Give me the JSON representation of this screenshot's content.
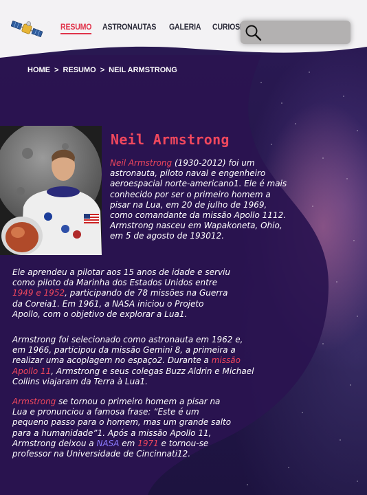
{
  "nav": {
    "items": [
      {
        "label": "RESUMO",
        "active": true
      },
      {
        "label": "ASTRONAUTAS",
        "active": false
      },
      {
        "label": "GALERIA",
        "active": false
      },
      {
        "label": "CURIOSIDADES",
        "active": false
      }
    ],
    "search_value": ""
  },
  "breadcrumb": {
    "home": "HOME",
    "sep": ">",
    "resumo": "RESUMO",
    "current": "NEIL ARMSTRONG"
  },
  "article": {
    "title": "Neil Armstrong",
    "p1": {
      "link": "Neil Armstrong",
      "text": " (1930-2012) foi um astronauta, piloto naval e engenheiro aeroespacial norte-americano1. Ele é mais conhecido por ser o primeiro homem a pisar na Lua, em 20 de julho de 1969, como comandante da missão Apollo 1112. Armstrong nasceu em Wapakoneta, Ohio, em 5 de agosto de 193012."
    },
    "p2": {
      "a": "Ele aprendeu a pilotar aos 15 anos de idade e serviu como piloto da Marinha dos Estados Unidos entre ",
      "link": "1949 e 1952",
      "b": ", participando de 78 missões na Guerra da Coreia1. Em 1961, a NASA iniciou o Projeto Apollo, com o objetivo de explorar a Lua1."
    },
    "p3": {
      "a": "Armstrong foi selecionado como astronauta em 1962 e, em 1966, participou da missão Gemini 8, a primeira a realizar uma acoplagem no espaço2. Durante a ",
      "link": "missão Apollo 11",
      "b": ", Armstrong e seus colegas Buzz Aldrin e Michael Collins viajaram da Terra à Lua1."
    },
    "p4": {
      "link1": "Armstrong",
      "a": " se tornou o primeiro homem a pisar na Lua e pronunciou a famosa frase: “Este é um pequeno passo para o homem, mas um grande salto para a humanidade”1. Após a missão Apollo 11, Armstrong deixou a ",
      "link2": "NASA",
      "b": " em ",
      "link3": "1971",
      "c": " e tornou-se professor na Universidade de Cincinnati12."
    }
  },
  "colors": {
    "accent": "#f0475d",
    "nasa_link": "#8b7bff",
    "background": "#1d1340",
    "header": "#f3f2f4"
  },
  "icons": [
    "satellite-logo-icon",
    "search-icon"
  ]
}
